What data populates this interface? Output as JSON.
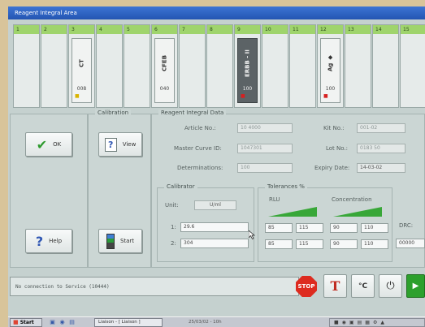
{
  "reagent_area": {
    "title": "Reagent Integral Area",
    "positions": [
      {
        "num": "1",
        "pack": null
      },
      {
        "num": "2",
        "pack": null
      },
      {
        "num": "3",
        "pack": {
          "name": "CT",
          "count": "008",
          "status": "yellow",
          "style": "light"
        }
      },
      {
        "num": "4",
        "pack": null
      },
      {
        "num": "5",
        "pack": null
      },
      {
        "num": "6",
        "pack": {
          "name": "CFEB",
          "count": "040",
          "status": "none",
          "style": "light"
        }
      },
      {
        "num": "7",
        "pack": null
      },
      {
        "num": "8",
        "pack": null
      },
      {
        "num": "9",
        "pack": {
          "name": "ERBB - II",
          "count": "100",
          "status": "red",
          "style": "dark"
        }
      },
      {
        "num": "10",
        "pack": null
      },
      {
        "num": "11",
        "pack": null
      },
      {
        "num": "12",
        "pack": {
          "name": "Ag ◆",
          "count": "100",
          "status": "red",
          "style": "light"
        }
      },
      {
        "num": "13",
        "pack": null
      },
      {
        "num": "14",
        "pack": null
      },
      {
        "num": "15",
        "pack": null
      }
    ]
  },
  "actions": {
    "ok_label": "OK",
    "help_label": "Help",
    "help_glyph": "?",
    "view_label": "View",
    "view_glyph": "?",
    "start_label": "Start"
  },
  "calibration": {
    "legend": "Calibration"
  },
  "reagent_data": {
    "legend": "Reagent Integral Data",
    "article_label": "Article No.:",
    "article_value": "10 4000",
    "master_curve_label": "Master Curve ID:",
    "master_curve_value": "1047301",
    "determinations_label": "Determinations:",
    "determinations_value": "100",
    "kit_label": "Kit No.:",
    "kit_value": "001-02",
    "lot_label": "Lot No.:",
    "lot_value": "0183 50",
    "expiry_label": "Expiry Date:",
    "expiry_value": "14-03-02"
  },
  "calibrator": {
    "legend": "Calibrator",
    "unit_label": "Unit:",
    "unit_value": "U/ml",
    "row1_label": "1:",
    "row1_value": "29.6",
    "row2_label": "2:",
    "row2_value": "304"
  },
  "tolerances": {
    "legend": "Tolerances %",
    "rlu_label": "RLU",
    "conc_label": "Concentration",
    "row1": [
      "85",
      "115",
      "90",
      "110"
    ],
    "row2": [
      "85",
      "115",
      "90",
      "110"
    ],
    "gray_color": "#38a738"
  },
  "drc": {
    "label": "DRC:",
    "value": "00000"
  },
  "message_bar": {
    "text": "No connection to Service (10444)"
  },
  "toolbar": {
    "stop_label": "STOP",
    "tool2_glyph": "T",
    "tool3_glyph": "°C",
    "tool4_glyph": "⏻"
  },
  "taskbar": {
    "start_label": "Start",
    "task_item": "Liaison - [ Liaison ]",
    "task_item_2": "25/03/02 - 10h",
    "tray_items": [
      "■",
      "◉",
      "▣",
      "▤",
      "▦",
      "⚙",
      "▲"
    ]
  }
}
